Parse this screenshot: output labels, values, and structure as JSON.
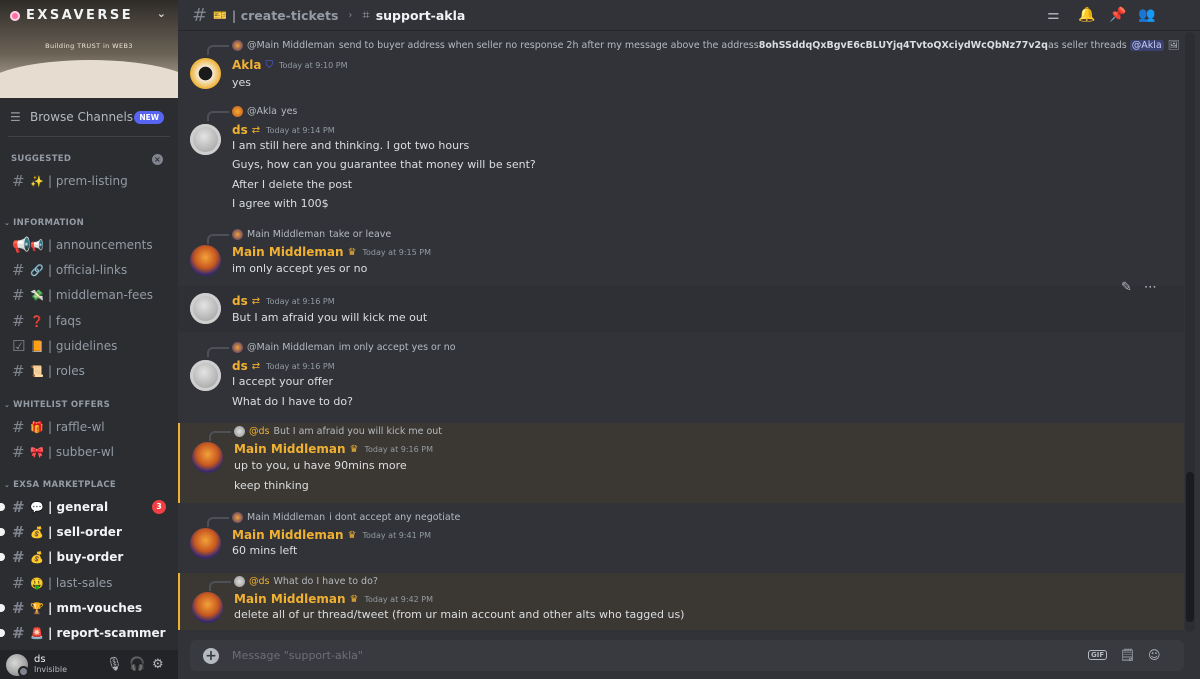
{
  "server": {
    "name": "EXSAVERSE",
    "banner_tagline": "Building TRUST in WEB3"
  },
  "browse": {
    "label": "Browse Channels",
    "badge": "NEW"
  },
  "categories": {
    "suggested": "SUGGESTED",
    "information": "INFORMATION",
    "whitelist": "WHITELIST OFFERS",
    "marketplace": "EXSA MARKETPLACE"
  },
  "channels": {
    "suggested": [
      {
        "label": "| prem-listing",
        "emoji": "✨"
      }
    ],
    "information": [
      {
        "label": "| announcements",
        "emoji": "📢"
      },
      {
        "label": "| official-links",
        "emoji": "🔗"
      },
      {
        "label": "| middleman-fees",
        "emoji": "💸"
      },
      {
        "label": "| faqs",
        "emoji": "❓"
      },
      {
        "label": "| guidelines",
        "emoji": "📙"
      },
      {
        "label": "| roles",
        "emoji": "📜"
      }
    ],
    "whitelist": [
      {
        "label": "| raffle-wl",
        "emoji": "🎁"
      },
      {
        "label": "| subber-wl",
        "emoji": "🎀"
      }
    ],
    "marketplace": [
      {
        "label": "| general",
        "emoji": "💬",
        "badge": "3"
      },
      {
        "label": "| sell-order",
        "emoji": "💰"
      },
      {
        "label": "| buy-order",
        "emoji": "💰"
      },
      {
        "label": "| last-sales",
        "emoji": "🤑"
      },
      {
        "label": "| mm-vouches",
        "emoji": "🏆"
      },
      {
        "label": "| report-scammer",
        "emoji": "🚨"
      }
    ]
  },
  "user": {
    "name": "ds",
    "status": "Invisible"
  },
  "topbar": {
    "channel": "| create-tickets",
    "thread": "support-akla"
  },
  "messages": [
    {
      "reply": {
        "name": "@Main Middleman",
        "text": "send to buyer address when seller no response 2h after my message above the address ",
        "bold": "8ohSSddqQxBgvE6cBLUYjq4TvtoQXciydWcQbNz77v2q",
        "tail": " as seller threads",
        "ping": "@Akla"
      },
      "author": "Akla",
      "time": "Today at 9:10 PM",
      "lines": [
        "yes"
      ]
    },
    {
      "reply": {
        "name": "@Akla",
        "text": "yes"
      },
      "author": "ds",
      "time": "Today at 9:14 PM",
      "lines": [
        "I am still here and thinking. I got two hours",
        "Guys, how can you guarantee that money will be sent?",
        "After I delete the post",
        "I agree with 100$"
      ]
    },
    {
      "reply": {
        "name": "Main Middleman",
        "text": "take or leave"
      },
      "author": "Main Middleman",
      "time": "Today at 9:15 PM",
      "lines": [
        "im only accept yes or no"
      ]
    },
    {
      "author": "ds",
      "time": "Today at 9:16 PM",
      "lines": [
        "But I am afraid you will kick me out"
      ]
    },
    {
      "reply": {
        "name": "@Main Middleman",
        "text": "im only accept yes or no"
      },
      "author": "ds",
      "time": "Today at 9:16 PM",
      "lines": [
        "I accept your offer",
        "What do I have to do?"
      ]
    },
    {
      "reply": {
        "name": "@ds",
        "text": "But I am afraid you will kick me out"
      },
      "author": "Main Middleman",
      "time": "Today at 9:16 PM",
      "lines": [
        "up to you, u have 90mins more",
        "keep thinking"
      ]
    },
    {
      "reply": {
        "name": "Main Middleman",
        "text": "i dont accept any negotiate"
      },
      "author": "Main Middleman",
      "time": "Today at 9:41 PM",
      "lines": [
        "60 mins left"
      ]
    },
    {
      "reply": {
        "name": "@ds",
        "text": "What do I have to do?"
      },
      "author": "Main Middleman",
      "time": "Today at 9:42 PM",
      "lines": [
        "delete all of ur thread/tweet (from ur main account and other alts who tagged us)"
      ]
    }
  ],
  "composer": {
    "placeholder": "Message \"support-akla\"",
    "gif": "GIF"
  },
  "colors": {
    "accent": "#5865f2",
    "username": "#f0b132",
    "highlight": "#3b3833",
    "mention": "#f23f43"
  }
}
